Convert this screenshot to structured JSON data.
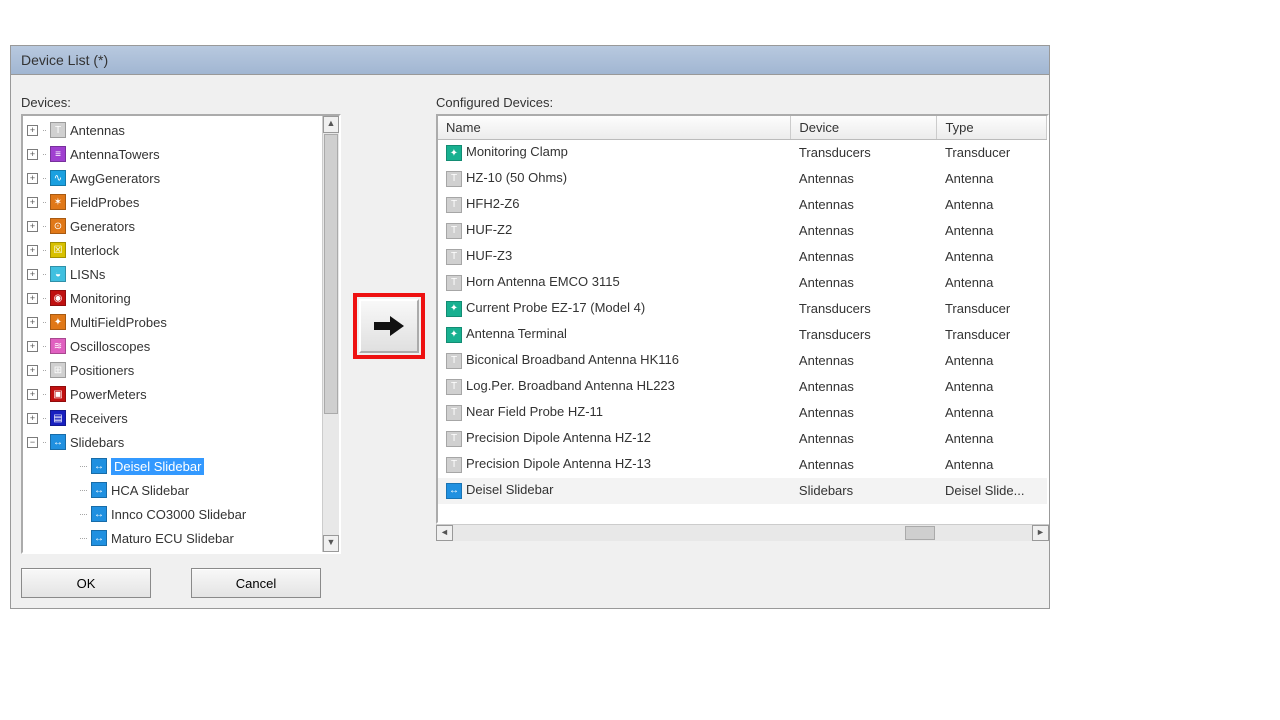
{
  "window": {
    "title": "Device List (*)"
  },
  "labels": {
    "devices": "Devices:",
    "configured": "Configured Devices:",
    "ok": "OK",
    "cancel": "Cancel"
  },
  "columns": {
    "name": "Name",
    "device": "Device",
    "type": "Type"
  },
  "tree": [
    {
      "label": "Antennas",
      "expand": "+",
      "color": "#d0d0d0",
      "glyph": "T"
    },
    {
      "label": "AntennaTowers",
      "expand": "+",
      "color": "#a040d0",
      "glyph": "≡"
    },
    {
      "label": "AwgGenerators",
      "expand": "+",
      "color": "#1aa0e0",
      "glyph": "∿"
    },
    {
      "label": "FieldProbes",
      "expand": "+",
      "color": "#e07818",
      "glyph": "✶"
    },
    {
      "label": "Generators",
      "expand": "+",
      "color": "#e07818",
      "glyph": "⊙"
    },
    {
      "label": "Interlock",
      "expand": "+",
      "color": "#d8c000",
      "glyph": "☒"
    },
    {
      "label": "LISNs",
      "expand": "+",
      "color": "#40c0e0",
      "glyph": "◒"
    },
    {
      "label": "Monitoring",
      "expand": "+",
      "color": "#c01010",
      "glyph": "◉"
    },
    {
      "label": "MultiFieldProbes",
      "expand": "+",
      "color": "#e07818",
      "glyph": "✦"
    },
    {
      "label": "Oscilloscopes",
      "expand": "+",
      "color": "#e060c0",
      "glyph": "≋"
    },
    {
      "label": "Positioners",
      "expand": "+",
      "color": "#d0d0d0",
      "glyph": "⊞"
    },
    {
      "label": "PowerMeters",
      "expand": "+",
      "color": "#c01010",
      "glyph": "▣"
    },
    {
      "label": "Receivers",
      "expand": "+",
      "color": "#1820c0",
      "glyph": "▤"
    },
    {
      "label": "Slidebars",
      "expand": "−",
      "color": "#2090e0",
      "glyph": "↔",
      "children": [
        {
          "label": "Deisel Slidebar",
          "color": "#2090e0",
          "glyph": "↔",
          "selected": true
        },
        {
          "label": "HCA Slidebar",
          "color": "#2090e0",
          "glyph": "↔"
        },
        {
          "label": "Innco CO3000 Slidebar",
          "color": "#2090e0",
          "glyph": "↔"
        },
        {
          "label": "Maturo ECU Slidebar",
          "color": "#2090e0",
          "glyph": "↔"
        }
      ]
    }
  ],
  "configured": [
    {
      "name": "Monitoring Clamp",
      "device": "Transducers",
      "type": "Transducer",
      "color": "#18b090",
      "glyph": "✦"
    },
    {
      "name": "HZ-10 (50 Ohms)",
      "device": "Antennas",
      "type": "Antenna",
      "color": "#d0d0d0",
      "glyph": "T"
    },
    {
      "name": "HFH2-Z6",
      "device": "Antennas",
      "type": "Antenna",
      "color": "#d0d0d0",
      "glyph": "T"
    },
    {
      "name": "HUF-Z2",
      "device": "Antennas",
      "type": "Antenna",
      "color": "#d0d0d0",
      "glyph": "T"
    },
    {
      "name": "HUF-Z3",
      "device": "Antennas",
      "type": "Antenna",
      "color": "#d0d0d0",
      "glyph": "T"
    },
    {
      "name": "Horn Antenna EMCO 3115",
      "device": "Antennas",
      "type": "Antenna",
      "color": "#d0d0d0",
      "glyph": "T"
    },
    {
      "name": "Current Probe EZ-17 (Model 4)",
      "device": "Transducers",
      "type": "Transducer",
      "color": "#18b090",
      "glyph": "✦"
    },
    {
      "name": "Antenna Terminal",
      "device": "Transducers",
      "type": "Transducer",
      "color": "#18b090",
      "glyph": "✦"
    },
    {
      "name": "Biconical Broadband Antenna HK116",
      "device": "Antennas",
      "type": "Antenna",
      "color": "#d0d0d0",
      "glyph": "T"
    },
    {
      "name": "Log.Per. Broadband Antenna HL223",
      "device": "Antennas",
      "type": "Antenna",
      "color": "#d0d0d0",
      "glyph": "T"
    },
    {
      "name": "Near Field Probe HZ-11",
      "device": "Antennas",
      "type": "Antenna",
      "color": "#d0d0d0",
      "glyph": "T"
    },
    {
      "name": "Precision Dipole Antenna HZ-12",
      "device": "Antennas",
      "type": "Antenna",
      "color": "#d0d0d0",
      "glyph": "T"
    },
    {
      "name": "Precision Dipole Antenna HZ-13",
      "device": "Antennas",
      "type": "Antenna",
      "color": "#d0d0d0",
      "glyph": "T"
    },
    {
      "name": "Deisel Slidebar",
      "device": "Slidebars",
      "type": "Deisel Slide...",
      "color": "#2090e0",
      "glyph": "↔",
      "selected": true
    }
  ]
}
